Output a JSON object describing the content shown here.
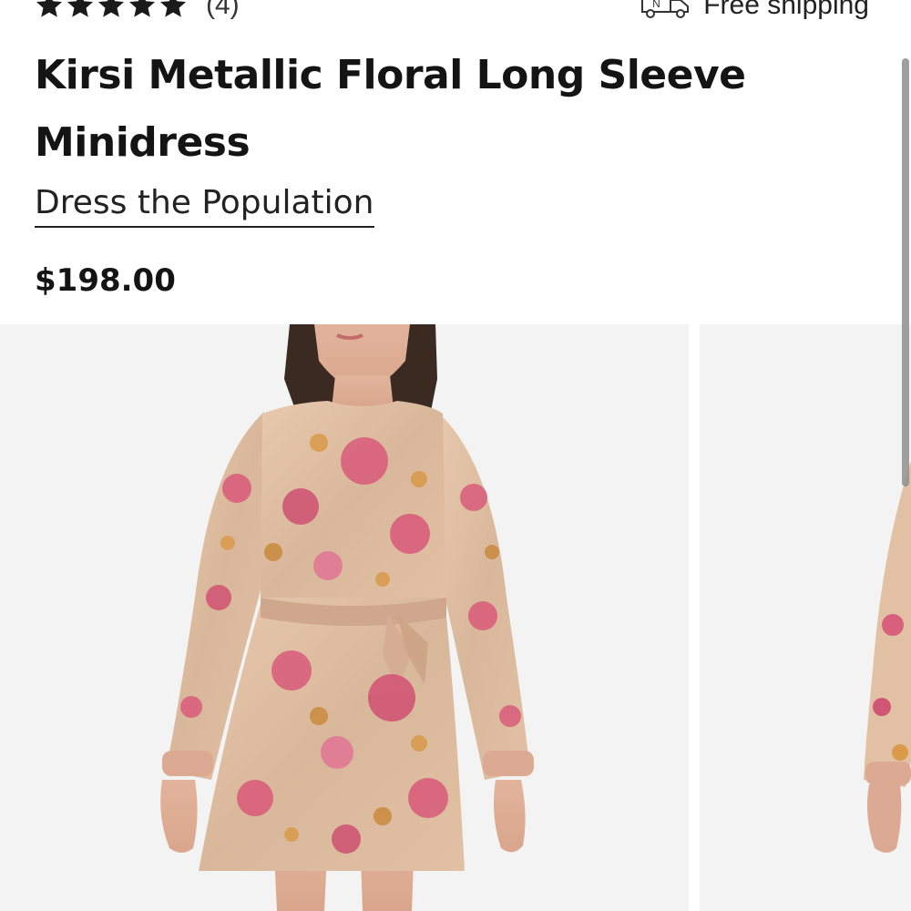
{
  "product": {
    "rating_stars": 5,
    "review_count": "(4)",
    "shipping": {
      "icon": "delivery-truck-icon",
      "truck_letter": "N",
      "label": "Free shipping"
    },
    "title": "Kirsi Metallic Floral Long Sleeve Minidress",
    "brand": "Dress the Population",
    "price": "$198.00"
  },
  "gallery": {
    "images": [
      {
        "subject": "model-wearing-floral-minidress"
      },
      {
        "subject": "model-wearing-floral-minidress-alt-view"
      }
    ]
  },
  "colors": {
    "text": "#141414",
    "image_bg": "#f3f3f3",
    "dress_pink": "#d9607c",
    "dress_gold": "#d8b58a"
  }
}
